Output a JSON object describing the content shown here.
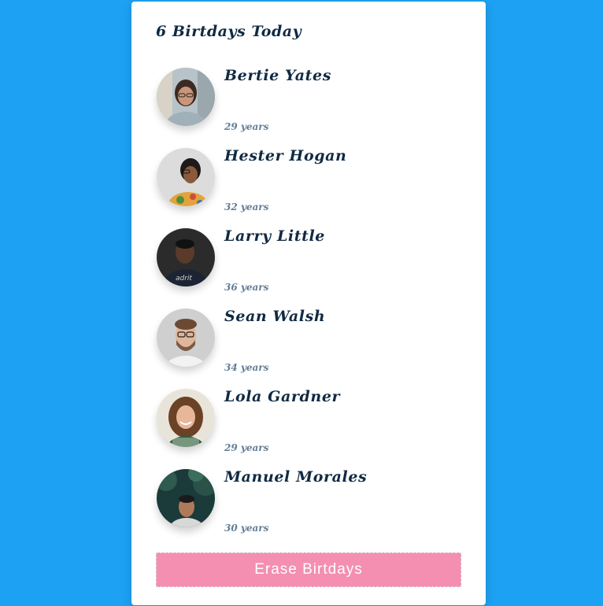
{
  "header": {
    "title": "6 Birtdays Today"
  },
  "people": [
    {
      "name": "Bertie Yates",
      "age": "29 years",
      "avatar": "avatar-photo-woman-glasses"
    },
    {
      "name": "Hester Hogan",
      "age": "32 years",
      "avatar": "avatar-photo-woman-floral-shirt"
    },
    {
      "name": "Larry Little",
      "age": "36 years",
      "avatar": "avatar-photo-man-dark-shirt"
    },
    {
      "name": "Sean Walsh",
      "age": "34 years",
      "avatar": "avatar-photo-man-glasses-beard"
    },
    {
      "name": "Lola Gardner",
      "age": "29 years",
      "avatar": "avatar-photo-woman-curly-hair"
    },
    {
      "name": "Manuel Morales",
      "age": "30 years",
      "avatar": "avatar-photo-man-trees-background"
    }
  ],
  "footer": {
    "erase_label": "Erase Birtdays"
  },
  "colors": {
    "background": "#1da1f2",
    "card": "#ffffff",
    "name_text": "#102a43",
    "age_text": "#617d98",
    "button": "#f48fb1"
  }
}
